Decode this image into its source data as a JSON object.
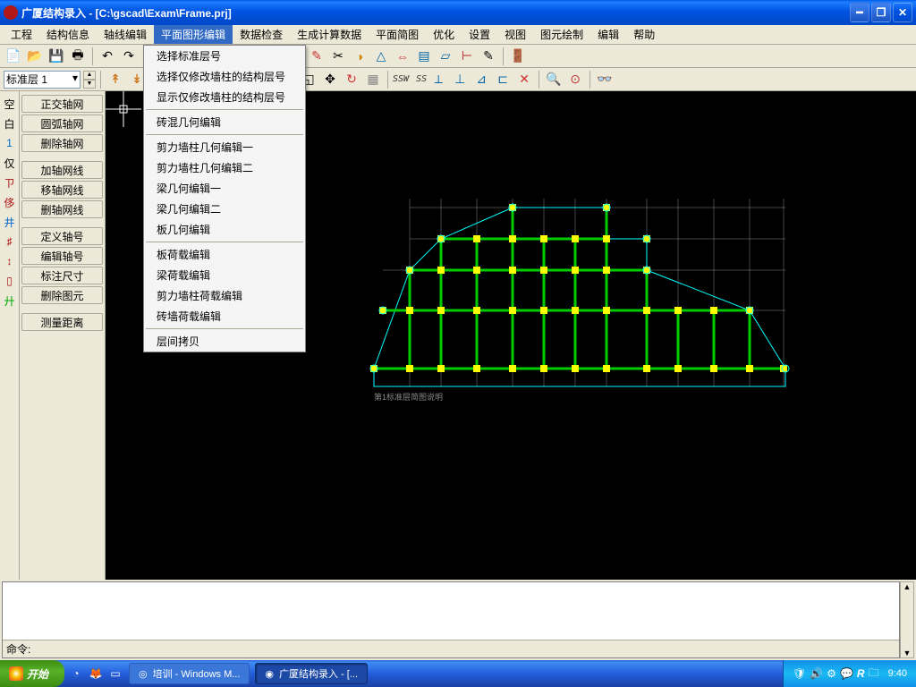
{
  "titlebar": {
    "text": "广厦结构录入 - [C:\\gscad\\Exam\\Frame.prj]"
  },
  "menubar": {
    "items": [
      "工程",
      "结构信息",
      "轴线编辑",
      "平面图形编辑",
      "数据检查",
      "生成计算数据",
      "平面简图",
      "优化",
      "设置",
      "视图",
      "图元绘制",
      "编辑",
      "帮助"
    ],
    "active_index": 3
  },
  "toolbar2": {
    "layer_label": "标准层 1",
    "ssw": "SSW",
    "ss": "SS"
  },
  "leftbar": {
    "groups": [
      [
        "正交轴网",
        "圆弧轴网",
        "删除轴网"
      ],
      [
        "加轴网线",
        "移轴网线",
        "删轴网线"
      ],
      [
        "定义轴号",
        "编辑轴号",
        "标注尺寸",
        "删除图元"
      ],
      [
        "测量距离"
      ]
    ]
  },
  "left_icons": [
    "空",
    "白",
    "1",
    "仅",
    "ㄗ",
    "侈",
    "井",
    "♯",
    "↕",
    "▯",
    "廾"
  ],
  "dropdown": {
    "groups": [
      [
        "选择标准层号",
        "选择仅修改墙柱的结构层号",
        "显示仅修改墙柱的结构层号"
      ],
      [
        "砖混几何编辑"
      ],
      [
        "剪力墙柱几何编辑一",
        "剪力墙柱几何编辑二",
        "梁几何编辑一",
        "梁几何编辑二",
        "板几何编辑"
      ],
      [
        "板荷载编辑",
        "梁荷载编辑",
        "剪力墙柱荷载编辑",
        "砖墙荷载编辑"
      ],
      [
        "层间拷贝"
      ]
    ]
  },
  "canvas": {
    "caption": "第1标准层简图说明"
  },
  "command": {
    "prompt": "命令:"
  },
  "taskbar": {
    "start": "开始",
    "tasks": [
      {
        "label": "培训 - Windows M...",
        "active": false
      },
      {
        "label": "广厦结构录入 - [...",
        "active": true
      }
    ],
    "time": "9:40"
  }
}
